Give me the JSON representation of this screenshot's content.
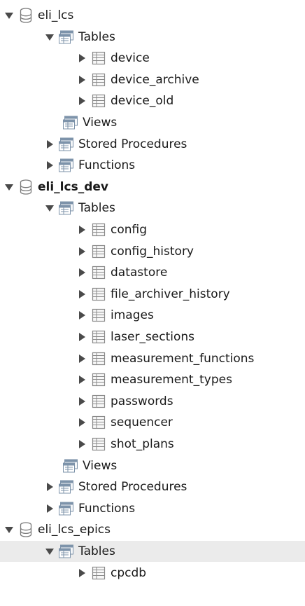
{
  "tree": [
    {
      "type": "schema",
      "label": "eli_lcs",
      "expanded": true,
      "bold": false
    },
    {
      "type": "folder",
      "label": "Tables",
      "expanded": true
    },
    {
      "type": "table",
      "label": "device"
    },
    {
      "type": "table",
      "label": "device_archive"
    },
    {
      "type": "table",
      "label": "device_old"
    },
    {
      "type": "folder",
      "label": "Views",
      "expanded": null
    },
    {
      "type": "folder",
      "label": "Stored Procedures",
      "expanded": false
    },
    {
      "type": "folder",
      "label": "Functions",
      "expanded": false
    },
    {
      "type": "schema",
      "label": "eli_lcs_dev",
      "expanded": true,
      "bold": true
    },
    {
      "type": "folder",
      "label": "Tables",
      "expanded": true
    },
    {
      "type": "table",
      "label": "config"
    },
    {
      "type": "table",
      "label": "config_history"
    },
    {
      "type": "table",
      "label": "datastore"
    },
    {
      "type": "table",
      "label": "file_archiver_history"
    },
    {
      "type": "table",
      "label": "images"
    },
    {
      "type": "table",
      "label": "laser_sections"
    },
    {
      "type": "table",
      "label": "measurement_functions"
    },
    {
      "type": "table",
      "label": "measurement_types"
    },
    {
      "type": "table",
      "label": "passwords"
    },
    {
      "type": "table",
      "label": "sequencer"
    },
    {
      "type": "table",
      "label": "shot_plans"
    },
    {
      "type": "folder",
      "label": "Views",
      "expanded": null
    },
    {
      "type": "folder",
      "label": "Stored Procedures",
      "expanded": false
    },
    {
      "type": "folder",
      "label": "Functions",
      "expanded": false
    },
    {
      "type": "schema",
      "label": "eli_lcs_epics",
      "expanded": true,
      "bold": false
    },
    {
      "type": "folder",
      "label": "Tables",
      "expanded": true,
      "selected": true
    },
    {
      "type": "table",
      "label": "cpcdb"
    }
  ],
  "icons": {
    "expanded": "triangle-down-icon",
    "collapsed": "triangle-right-icon",
    "schema": "database-icon",
    "folder": "folder-icon",
    "table": "table-icon"
  },
  "colors": {
    "arrow": "#4a4a4a",
    "selected_row": "#ebebeb",
    "db_outline": "#7a7a7a",
    "folder_blue": "#7d93aa",
    "table_grid": "#8a8a8a"
  }
}
